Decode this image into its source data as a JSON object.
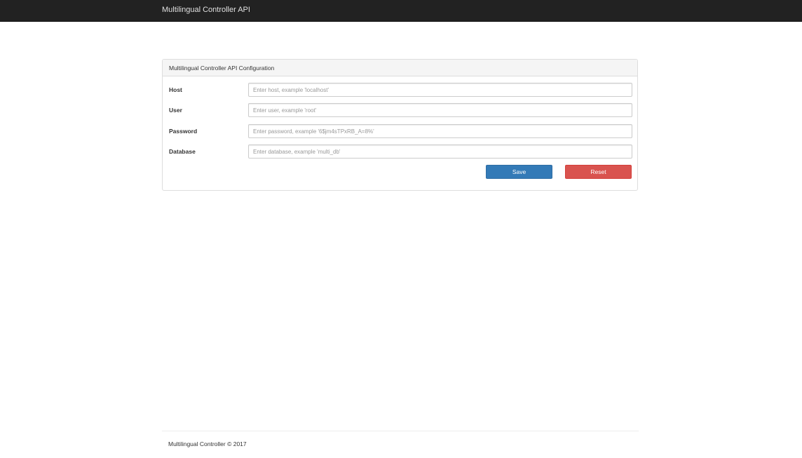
{
  "navbar": {
    "brand": "Multilingual Controller API"
  },
  "panel": {
    "title": "Multilingual Controller API Configuration",
    "fields": [
      {
        "label": "Host",
        "value": "",
        "placeholder": "Enter host, example 'localhost'"
      },
      {
        "label": "User",
        "value": "",
        "placeholder": "Enter user, example 'root'"
      },
      {
        "label": "Password",
        "value": "",
        "placeholder": "Enter password, example '6$jm4sTPxRB_A=8%'"
      },
      {
        "label": "Database",
        "value": "",
        "placeholder": "Enter database, example 'multi_db'"
      }
    ],
    "save_label": "Save",
    "reset_label": "Reset"
  },
  "footer": {
    "text": "Multilingual Controller © 2017"
  },
  "colors": {
    "navbar_bg": "#222222",
    "primary": "#337ab7",
    "danger": "#d9534f"
  }
}
